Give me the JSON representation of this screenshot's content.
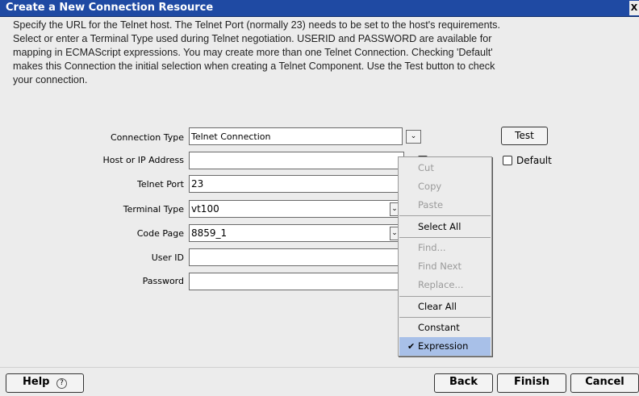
{
  "window": {
    "title": "Create a New Connection Resource",
    "close_glyph": "X"
  },
  "description": "Specify the URL for the Telnet host.  The Telnet Port (normally 23) needs to be set to the host's requirements.\nSelect or enter a Terminal Type used during Telnet negotiation.  USERID and PASSWORD are available for\nmapping in ECMAScript expressions.  You may create more than one Telnet Connection.  Checking 'Default'\nmakes this Connection the initial selection when creating a Telnet Component.  Use the Test button to check\nyour connection.",
  "form": {
    "connection_type": {
      "label": "Connection Type",
      "value": "Telnet Connection"
    },
    "host": {
      "label": "Host or IP Address",
      "value": ""
    },
    "telnet_port": {
      "label": "Telnet Port",
      "value": "23"
    },
    "terminal_type": {
      "label": "Terminal Type",
      "value": "vt100"
    },
    "code_page": {
      "label": "Code Page",
      "value": "8859_1"
    },
    "user_id": {
      "label": "User ID",
      "value": ""
    },
    "password": {
      "label": "Password",
      "value": ""
    },
    "test_button": "Test",
    "default_checkbox": {
      "label": "Default",
      "checked": false
    },
    "dropdown_glyph": "⌄"
  },
  "context_menu": {
    "items": [
      {
        "label": "Cut",
        "enabled": false
      },
      {
        "label": "Copy",
        "enabled": false
      },
      {
        "label": "Paste",
        "enabled": false
      },
      {
        "label": "Select All",
        "enabled": true
      },
      {
        "label": "Find...",
        "enabled": false
      },
      {
        "label": "Find Next",
        "enabled": false
      },
      {
        "label": "Replace...",
        "enabled": false
      },
      {
        "label": "Clear All",
        "enabled": true
      },
      {
        "label": "Constant",
        "enabled": true
      },
      {
        "label": "Expression",
        "enabled": true,
        "checked": true,
        "selected": true
      }
    ],
    "check_glyph": "✔"
  },
  "footer": {
    "help": "Help",
    "help_icon": "?",
    "back": "Back",
    "finish": "Finish",
    "cancel": "Cancel"
  },
  "colors": {
    "titlebar": "#1f4aa3",
    "menu_selected": "#a8c0e8"
  }
}
